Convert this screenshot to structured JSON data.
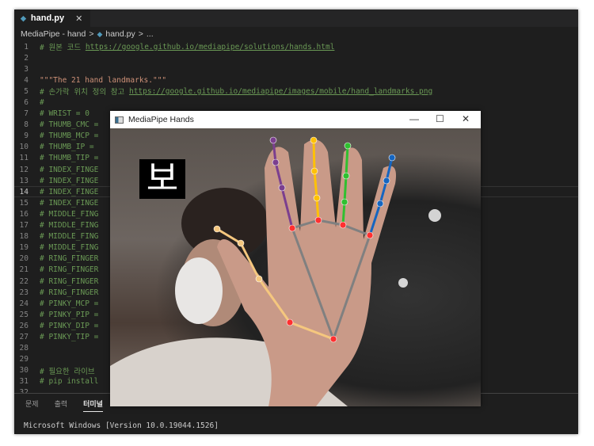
{
  "editor": {
    "tab": {
      "icon": "python-file-icon",
      "label": "hand.py",
      "close": "✕"
    },
    "breadcrumb": [
      "MediaPipe - hand",
      ">",
      "hand.py",
      ">",
      "..."
    ],
    "lines": [
      {
        "n": "1",
        "parts": [
          {
            "t": "# 원본 코드 ",
            "c": "cm"
          },
          {
            "t": "https://google.github.io/mediapipe/solutions/hands.html",
            "c": "url"
          }
        ]
      },
      {
        "n": "2",
        "parts": []
      },
      {
        "n": "3",
        "parts": []
      },
      {
        "n": "4",
        "parts": [
          {
            "t": "\"\"\"The 21 hand landmarks.\"\"\"",
            "c": "str"
          }
        ]
      },
      {
        "n": "5",
        "parts": [
          {
            "t": "# 손가락 위치 정의 참고 ",
            "c": "cm"
          },
          {
            "t": "https://google.github.io/mediapipe/images/mobile/hand_landmarks.png",
            "c": "url"
          }
        ]
      },
      {
        "n": "6",
        "parts": [
          {
            "t": "#",
            "c": "cm"
          }
        ]
      },
      {
        "n": "7",
        "parts": [
          {
            "t": "# WRIST = 0",
            "c": "cm"
          }
        ]
      },
      {
        "n": "8",
        "parts": [
          {
            "t": "# THUMB_CMC =",
            "c": "cm"
          }
        ]
      },
      {
        "n": "9",
        "parts": [
          {
            "t": "# THUMB_MCP =",
            "c": "cm"
          }
        ]
      },
      {
        "n": "10",
        "parts": [
          {
            "t": "# THUMB_IP =",
            "c": "cm"
          }
        ]
      },
      {
        "n": "11",
        "parts": [
          {
            "t": "# THUMB_TIP =",
            "c": "cm"
          }
        ]
      },
      {
        "n": "12",
        "parts": [
          {
            "t": "# INDEX_FINGE",
            "c": "cm"
          }
        ]
      },
      {
        "n": "13",
        "parts": [
          {
            "t": "# INDEX_FINGE",
            "c": "cm"
          }
        ]
      },
      {
        "n": "14",
        "parts": [
          {
            "t": "# INDEX_FINGE",
            "c": "cm"
          }
        ],
        "current": true
      },
      {
        "n": "15",
        "parts": [
          {
            "t": "# INDEX_FINGE",
            "c": "cm"
          }
        ]
      },
      {
        "n": "16",
        "parts": [
          {
            "t": "# MIDDLE_FING",
            "c": "cm"
          }
        ]
      },
      {
        "n": "17",
        "parts": [
          {
            "t": "# MIDDLE_FING",
            "c": "cm"
          }
        ]
      },
      {
        "n": "18",
        "parts": [
          {
            "t": "# MIDDLE_FING",
            "c": "cm"
          }
        ]
      },
      {
        "n": "19",
        "parts": [
          {
            "t": "# MIDDLE_FING",
            "c": "cm"
          }
        ]
      },
      {
        "n": "20",
        "parts": [
          {
            "t": "# RING_FINGER",
            "c": "cm"
          }
        ]
      },
      {
        "n": "21",
        "parts": [
          {
            "t": "# RING_FINGER",
            "c": "cm"
          }
        ]
      },
      {
        "n": "22",
        "parts": [
          {
            "t": "# RING_FINGER",
            "c": "cm"
          }
        ]
      },
      {
        "n": "23",
        "parts": [
          {
            "t": "# RING_FINGER",
            "c": "cm"
          }
        ]
      },
      {
        "n": "24",
        "parts": [
          {
            "t": "# PINKY_MCP =",
            "c": "cm"
          }
        ]
      },
      {
        "n": "25",
        "parts": [
          {
            "t": "# PINKY_PIP =",
            "c": "cm"
          }
        ]
      },
      {
        "n": "26",
        "parts": [
          {
            "t": "# PINKY_DIP =",
            "c": "cm"
          }
        ]
      },
      {
        "n": "27",
        "parts": [
          {
            "t": "# PINKY_TIP =",
            "c": "cm"
          }
        ]
      },
      {
        "n": "28",
        "parts": []
      },
      {
        "n": "29",
        "parts": []
      },
      {
        "n": "30",
        "parts": [
          {
            "t": "# 필요한 라이브",
            "c": "cm"
          }
        ]
      },
      {
        "n": "31",
        "parts": [
          {
            "t": "# pip install",
            "c": "cm"
          }
        ]
      },
      {
        "n": "32",
        "parts": []
      }
    ]
  },
  "panel": {
    "tabs": [
      "문제",
      "출력",
      "터미널"
    ],
    "active": "터미널",
    "terminal": "Microsoft Windows [Version 10.0.19044.1526]"
  },
  "window": {
    "title": "MediaPipe Hands",
    "minimize": "—",
    "maximize": "☐",
    "close": "✕",
    "overlay_text": "보"
  },
  "landmark_colors": {
    "thumb": "#f5c77e",
    "index": "#1565c0",
    "middle": "#30c030",
    "ring": "#ffc107",
    "pinky": "#7b3f8f",
    "palm": "#808080",
    "joint": "#ff3030"
  }
}
